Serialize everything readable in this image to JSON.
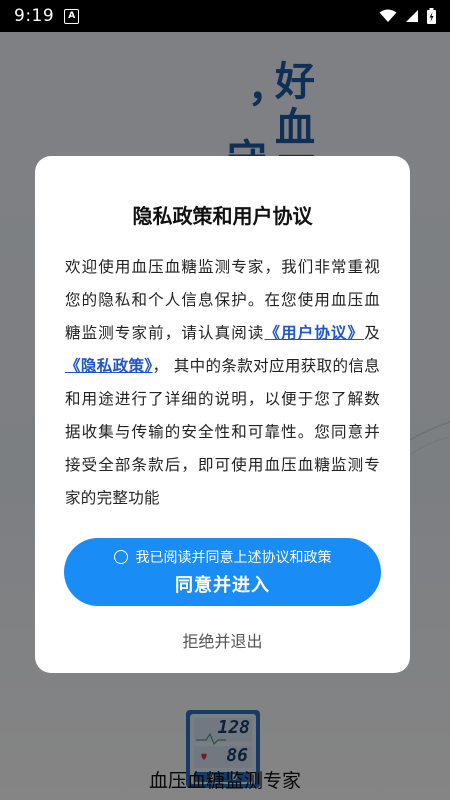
{
  "status_bar": {
    "time": "9:19",
    "notification_icon": "A"
  },
  "background": {
    "slogan_line1": "好血压",
    "slogan_line2": "，守护",
    "app_name": "血压血糖监测专家",
    "logo": {
      "systolic": "128",
      "diastolic": "86"
    }
  },
  "dialog": {
    "title": "隐私政策和用户协议",
    "body": {
      "part1": "欢迎使用血压血糖监测专家，我们非常重视您的隐私和个人信息保护。在您使用血压血糖监测专家前，请认真阅读",
      "user_agreement_link": "《用户协议》",
      "and": "及",
      "privacy_policy_link": "《隐私政策》",
      "part2": "， 其中的条款对应用获取的信息和用途进行了详细的说明，以便于您了解数据收集与传输的安全性和可靠性。您同意并接受全部条款后，即可使用血压血糖监测专家的完整功能"
    },
    "consent_text": "我已阅读并同意上述协议和政策",
    "agree_button": "同意并进入",
    "reject_button": "拒绝并退出"
  },
  "colors": {
    "accent": "#1a8cf6",
    "link": "#1e55c8",
    "slogan": "#1f5aa8"
  }
}
